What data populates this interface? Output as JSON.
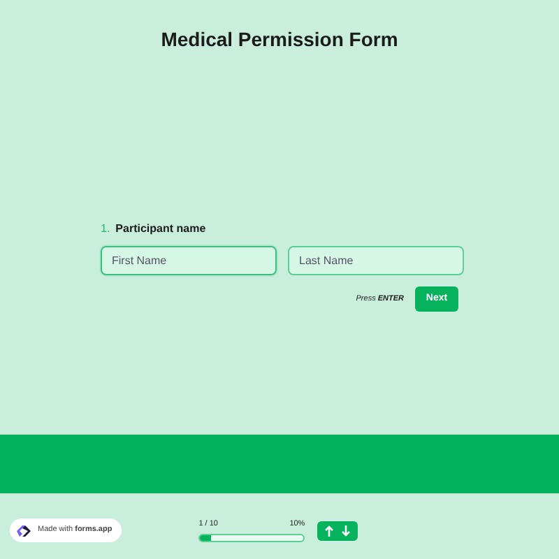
{
  "title": "Medical Permission Form",
  "question": {
    "number": "1.",
    "label": "Participant name",
    "fields": [
      {
        "placeholder": "First Name",
        "focused": true
      },
      {
        "placeholder": "Last Name",
        "focused": false
      }
    ]
  },
  "hint": "Press **ENTER**",
  "next_button": "Next",
  "badge": "Made with **forms.app**",
  "progress": {
    "count": "1 / 10",
    "percent": "10%",
    "level": 0.1
  }
}
